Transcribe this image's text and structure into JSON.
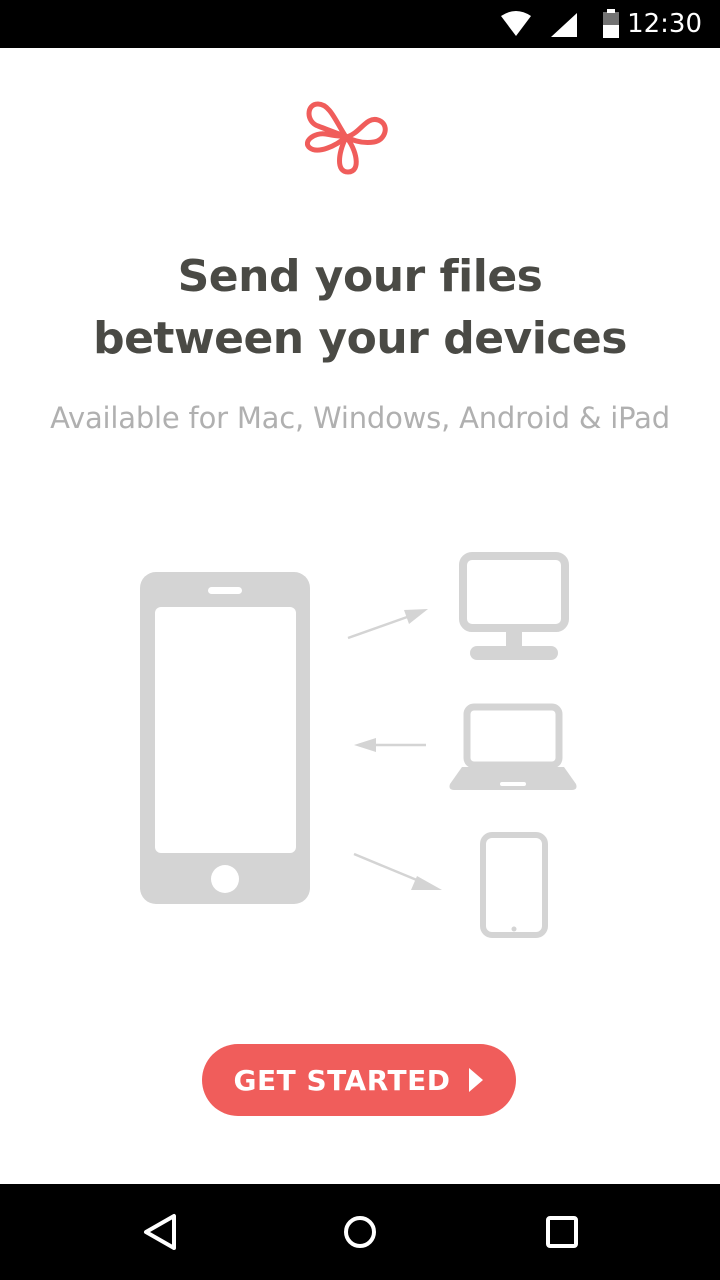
{
  "status_bar": {
    "time": "12:30",
    "icons": [
      "wifi-icon",
      "signal-icon",
      "battery-icon"
    ]
  },
  "logo": {
    "icon": "cloverleaf-logo-icon",
    "color": "#f05d5b"
  },
  "headline": {
    "line1": "Send your files",
    "line2": "between your devices"
  },
  "subtitle": "Available for Mac, Windows, Android & iPad",
  "illustration": {
    "source_device": "smartphone-icon",
    "targets": [
      "desktop-monitor-icon",
      "laptop-icon",
      "tablet-icon"
    ],
    "color": "#d4d4d4"
  },
  "cta": {
    "label": "GET STARTED",
    "icon": "play-arrow-icon",
    "color": "#f05d5b"
  },
  "nav_bar": {
    "buttons": [
      "back-icon",
      "home-icon",
      "recents-icon"
    ]
  }
}
